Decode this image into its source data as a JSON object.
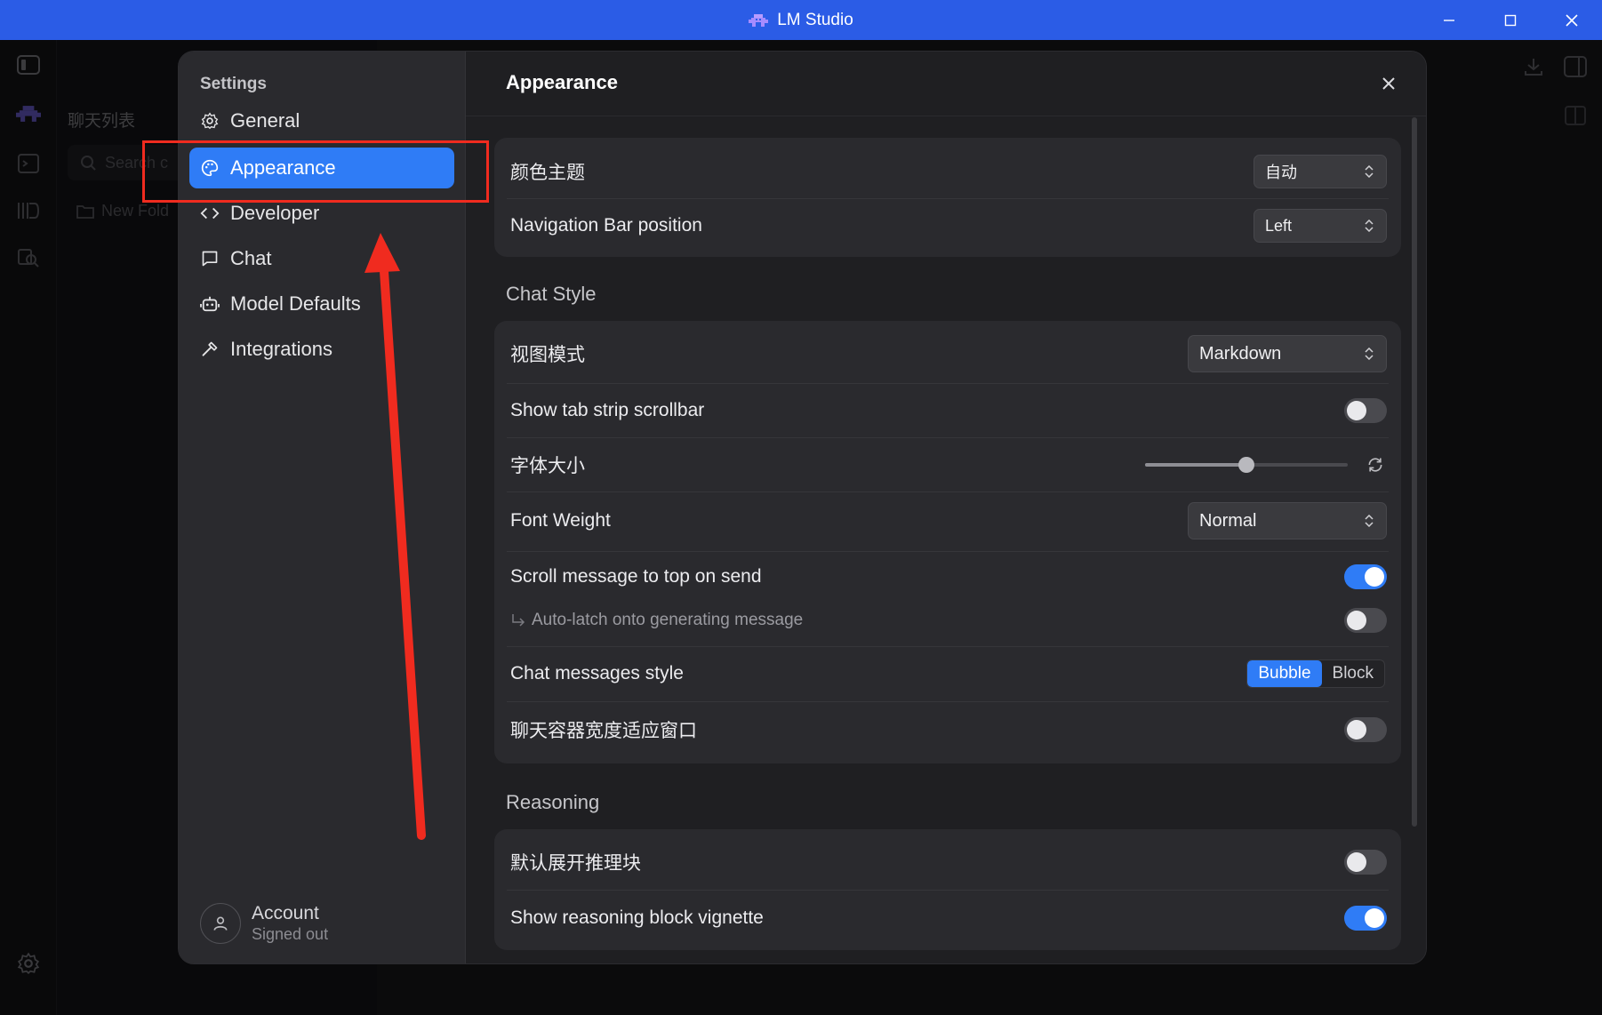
{
  "window": {
    "title": "LM Studio"
  },
  "background": {
    "chat_list_title": "聊天列表",
    "search_placeholder": "Search c",
    "new_folder_label": "New Fold"
  },
  "settings": {
    "title": "Settings",
    "nav": [
      {
        "label": "General",
        "icon": "gear-icon"
      },
      {
        "label": "Appearance",
        "icon": "palette-icon",
        "active": true
      },
      {
        "label": "Developer",
        "icon": "code-icon"
      },
      {
        "label": "Chat",
        "icon": "chat-bubble-icon"
      },
      {
        "label": "Model Defaults",
        "icon": "robot-icon"
      },
      {
        "label": "Integrations",
        "icon": "hammer-icon"
      }
    ],
    "account": {
      "name": "Account",
      "status": "Signed out"
    }
  },
  "appearance": {
    "title": "Appearance",
    "color_theme": {
      "label": "颜色主题",
      "value": "自动"
    },
    "nav_bar_position": {
      "label": "Navigation Bar position",
      "value": "Left"
    },
    "chat_style": {
      "heading": "Chat Style",
      "view_mode": {
        "label": "视图模式",
        "value": "Markdown"
      },
      "tab_strip_scrollbar": {
        "label": "Show tab strip scrollbar",
        "on": false
      },
      "font_size": {
        "label": "字体大小",
        "level": 0.5
      },
      "font_weight": {
        "label": "Font Weight",
        "value": "Normal"
      },
      "scroll_to_top": {
        "label": "Scroll message to top on send",
        "on": true
      },
      "auto_latch": {
        "label": "Auto-latch onto generating message",
        "on": false
      },
      "messages_style": {
        "label": "Chat messages style",
        "options": [
          "Bubble",
          "Block"
        ],
        "selected": "Bubble"
      },
      "fit_width": {
        "label": "聊天容器宽度适应窗口",
        "on": false
      }
    },
    "reasoning": {
      "heading": "Reasoning",
      "expand_default": {
        "label": "默认展开推理块",
        "on": false
      },
      "vignette": {
        "label": "Show reasoning block vignette",
        "on": true
      }
    }
  },
  "colors": {
    "accent": "#2f7cf6",
    "titlebar": "#2b5ce6",
    "annotation": "#f02b1f"
  }
}
